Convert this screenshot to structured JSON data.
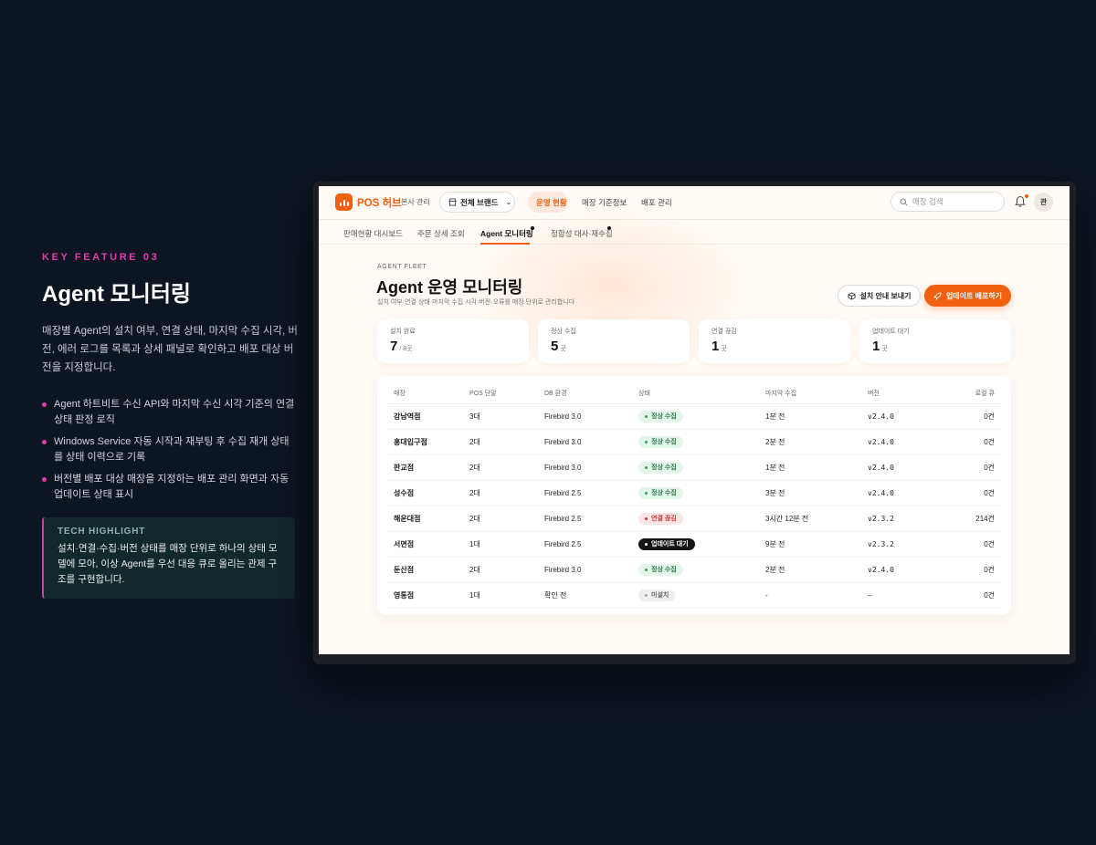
{
  "feature": {
    "eyebrow": "KEY FEATURE 03",
    "title": "Agent 모니터링",
    "description": "매장별 Agent의 설치 여부, 연결 상태, 마지막 수집 시각, 버전, 에러 로그를 목록과 상세 패널로 확인하고 배포 대상 버전을 지정합니다.",
    "bullets": [
      "Agent 하트비트 수신 API와 마지막 수신 시각 기준의 연결 상태 판정 로직",
      "Windows Service 자동 시작과 재부팅 후 수집 재개 상태를 상태 이력으로 기록",
      "버전별 배포 대상 매장을 지정하는 배포 관리 화면과 자동 업데이트 상태 표시"
    ],
    "tech_title": "TECH HIGHLIGHT",
    "tech_text": "설치·연결·수집·버전 상태를 매장 단위로 하나의 상태 모델에 모아, 이상 Agent를 우선 대응 큐로 올리는 관제 구조를 구현합니다."
  },
  "app": {
    "brand": "POS 허브",
    "brand_sub": "본사 관리",
    "brand_select": "전체 브랜드",
    "nav": [
      "운영 현황",
      "매장 기준정보",
      "배포 관리"
    ],
    "search_placeholder": "매장 검색",
    "avatar": "관",
    "subnav": [
      "판매현황 대시보드",
      "주문 상세 조회",
      "Agent 모니터링",
      "정합성 대사·재수집"
    ],
    "eyebrow": "AGENT FLEET",
    "title": "Agent 운영 모니터링",
    "subtitle": "설치 여부·연결 상태·마지막 수집 시각·버전·오류를 매장 단위로 관리합니다",
    "btn_guide": "설치 안내 보내기",
    "btn_deploy": "업데이트 배포하기",
    "stats": [
      {
        "label": "설치 완료",
        "value": "7",
        "unit": "/ 8곳"
      },
      {
        "label": "정상 수집",
        "value": "5",
        "unit": "곳"
      },
      {
        "label": "연결 끊김",
        "value": "1",
        "unit": "곳"
      },
      {
        "label": "업데이트 대기",
        "value": "1",
        "unit": "곳"
      }
    ],
    "table": {
      "headers": [
        "매장",
        "POS 단말",
        "DB 환경",
        "상태",
        "마지막 수집",
        "버전",
        "로컬 큐"
      ],
      "rows": [
        {
          "store": "강남역점",
          "pos": "3대",
          "db": "Firebird 3.0",
          "status": "정상 수집",
          "kind": "normal",
          "last": "1분 전",
          "version": "v2.4.0",
          "queue": "0건"
        },
        {
          "store": "홍대입구점",
          "pos": "2대",
          "db": "Firebird 3.0",
          "status": "정상 수집",
          "kind": "normal",
          "last": "2분 전",
          "version": "v2.4.0",
          "queue": "0건"
        },
        {
          "store": "판교점",
          "pos": "2대",
          "db": "Firebird 3.0",
          "status": "정상 수집",
          "kind": "normal",
          "last": "1분 전",
          "version": "v2.4.0",
          "queue": "0건"
        },
        {
          "store": "성수점",
          "pos": "2대",
          "db": "Firebird 2.5",
          "status": "정상 수집",
          "kind": "normal",
          "last": "3분 전",
          "version": "v2.4.0",
          "queue": "0건"
        },
        {
          "store": "해운대점",
          "pos": "2대",
          "db": "Firebird 2.5",
          "status": "연결 끊김",
          "kind": "down",
          "last": "3시간 12분 전",
          "version": "v2.3.2",
          "queue": "214건"
        },
        {
          "store": "서면점",
          "pos": "1대",
          "db": "Firebird 2.5",
          "status": "업데이트 대기",
          "kind": "update",
          "last": "9분 전",
          "version": "v2.3.2",
          "queue": "0건"
        },
        {
          "store": "둔산점",
          "pos": "2대",
          "db": "Firebird 3.0",
          "status": "정상 수집",
          "kind": "normal",
          "last": "2분 전",
          "version": "v2.4.0",
          "queue": "0건"
        },
        {
          "store": "영통점",
          "pos": "1대",
          "db": "확인 전",
          "status": "미설치",
          "kind": "none",
          "last": "-",
          "version": "–",
          "queue": "0건"
        }
      ]
    }
  }
}
